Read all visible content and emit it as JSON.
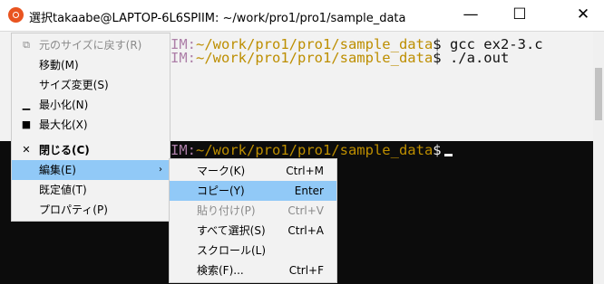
{
  "window": {
    "title": "選択takaabe@LAPTOP-6L6SPIIM: ~/work/pro1/pro1/sample_data",
    "minimize": "—",
    "maximize": "☐",
    "close": "✕"
  },
  "terminal": {
    "lines": [
      {
        "host": "IM:",
        "path": "~/work/pro1/pro1/sample_data",
        "prompt": "$ ",
        "cmd": "gcc ex2-3.c"
      },
      {
        "host": "IM:",
        "path": "~/work/pro1/pro1/sample_data",
        "prompt": "$ ",
        "cmd": "./a.out"
      },
      {
        "host": "IM:",
        "path": "~/work/pro1/pro1/sample_data",
        "prompt": "$",
        "cmd": ""
      }
    ]
  },
  "system_menu": {
    "items": [
      {
        "icon": "restore-icon",
        "glyph": "⧉",
        "label": "元のサイズに戻す(R)",
        "disabled": true
      },
      {
        "icon": "",
        "glyph": "",
        "label": "移動(M)"
      },
      {
        "icon": "",
        "glyph": "",
        "label": "サイズ変更(S)"
      },
      {
        "icon": "minimize-icon",
        "glyph": "▁",
        "label": "最小化(N)"
      },
      {
        "icon": "maximize-icon",
        "glyph": "■",
        "label": "最大化(X)"
      },
      {
        "icon": "close-icon",
        "glyph": "✕",
        "label": "閉じる(C)",
        "bold": true
      },
      {
        "icon": "",
        "glyph": "",
        "label": "編集(E)",
        "arrow": "›",
        "highlighted": true
      },
      {
        "icon": "",
        "glyph": "",
        "label": "既定値(T)"
      },
      {
        "icon": "",
        "glyph": "",
        "label": "プロパティ(P)"
      }
    ]
  },
  "edit_submenu": {
    "items": [
      {
        "label": "マーク(K)",
        "shortcut": "Ctrl+M"
      },
      {
        "label": "コピー(Y)",
        "shortcut": "Enter",
        "highlighted": true
      },
      {
        "label": "貼り付け(P)",
        "shortcut": "Ctrl+V",
        "disabled": true
      },
      {
        "label": "すべて選択(S)",
        "shortcut": "Ctrl+A"
      },
      {
        "label": "スクロール(L)",
        "shortcut": ""
      },
      {
        "label": "検索(F)...",
        "shortcut": "Ctrl+F"
      }
    ]
  }
}
